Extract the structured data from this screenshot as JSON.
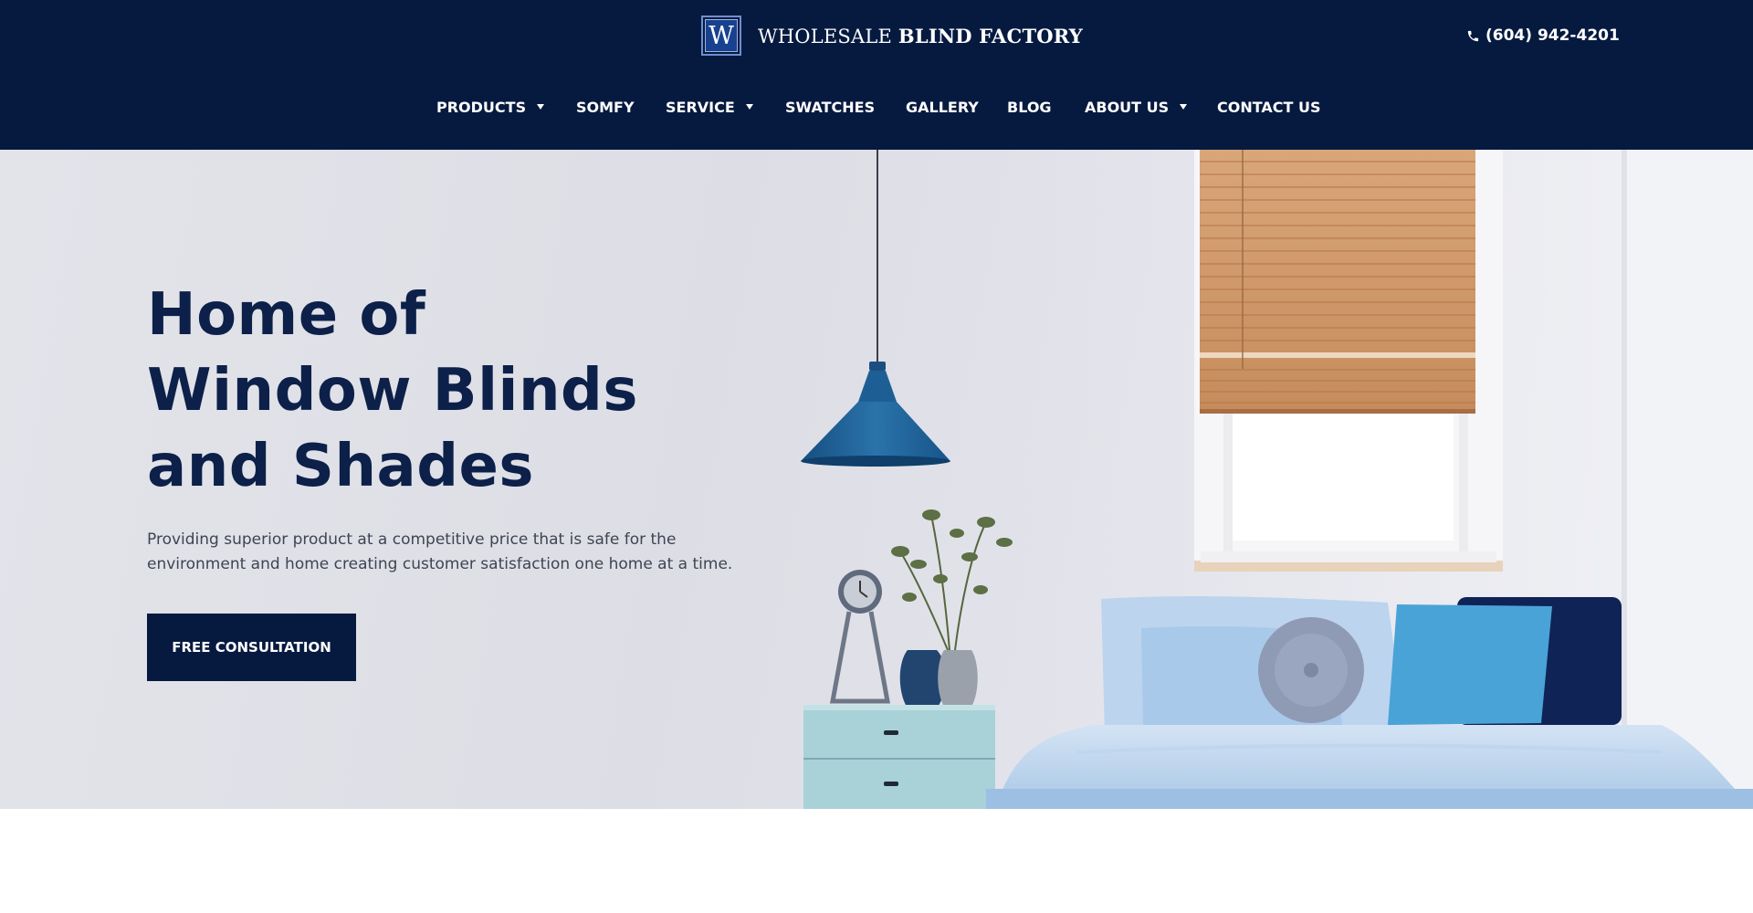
{
  "header": {
    "logo_letter": "W",
    "logo_text_light": "WHOLESALE",
    "logo_text_bold": "BLIND FACTORY",
    "phone_icon": "phone-icon",
    "phone": "(604) 942-4201"
  },
  "nav": {
    "items": [
      {
        "label": "PRODUCTS",
        "dropdown": true
      },
      {
        "label": "SOMFY",
        "dropdown": false
      },
      {
        "label": "SERVICE",
        "dropdown": true
      },
      {
        "label": "SWATCHES",
        "dropdown": false
      },
      {
        "label": "GALLERY",
        "dropdown": false
      },
      {
        "label": "BLOG",
        "dropdown": false
      },
      {
        "label": "ABOUT US",
        "dropdown": true
      },
      {
        "label": "CONTACT US",
        "dropdown": false
      }
    ]
  },
  "hero": {
    "title_lines": [
      "Home of",
      "Window Blinds",
      "and Shades"
    ],
    "description_lines": [
      "Providing superior product at a competitive price that is safe for the",
      "environment and home creating customer satisfaction one home at a time."
    ],
    "cta_label": "FREE CONSULTATION"
  },
  "colors": {
    "navy": "#061a40",
    "heading": "#0c2049",
    "lamp_blue": "#1c5f95",
    "pillow_blue": "#4aa3d6"
  }
}
